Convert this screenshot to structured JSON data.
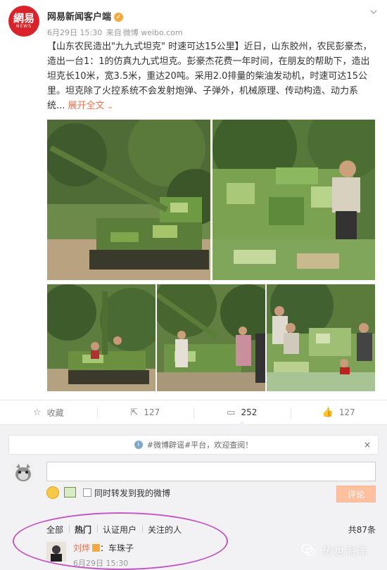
{
  "post": {
    "author": "网易新闻客户端",
    "avatar_logo_text": "網易",
    "avatar_logo_sub": "NEWS",
    "date": "6月29日 15:30",
    "from_label": "来自",
    "source": "微博 weibo.com",
    "lines": [
      "【山东农民造出\"九九式坦克\" 时速可达15公里】近日，山东胶州，农民彭豪杰，",
      "造出一台1：1的仿真九九式坦克。彭豪杰花费一年时间，在朋友的帮助下，造出",
      "坦克长10米，宽3.5米，重达20吨。采用2.0排量的柴油发动机，时速可达15公",
      "里。坦克除了火控系统不会发射炮弹、子弹外，机械原理、传动构造、动力系"
    ],
    "last_line_prefix": "统...",
    "expand_label": "展开全文",
    "expand_arrow": "⌄"
  },
  "actions": {
    "favorite": {
      "icon": "☆",
      "label": "收藏"
    },
    "repost": {
      "icon": "⇱",
      "label": "127"
    },
    "comment": {
      "icon": "▭",
      "label": "252"
    },
    "like": {
      "icon": "👍",
      "label": "127"
    }
  },
  "notice": {
    "icon": "i",
    "text": "#微博辟谣#平台，欢迎查阅！",
    "close": "×"
  },
  "composer": {
    "repost_label": "同时转发到我的微博",
    "submit_label": "评论"
  },
  "filters": [
    "全部",
    "热门",
    "认证用户",
    "关注的人"
  ],
  "total": "共87条",
  "comment": {
    "user": "刘烨",
    "text": "：车珠子",
    "time": "6月29日 15:30"
  },
  "watermark": "传世海洋",
  "colors": {
    "brand_red": "#d9232a",
    "link_orange": "#eb7350",
    "annotation_purple": "#c158c2",
    "camo_green": "#6f8f3a"
  }
}
